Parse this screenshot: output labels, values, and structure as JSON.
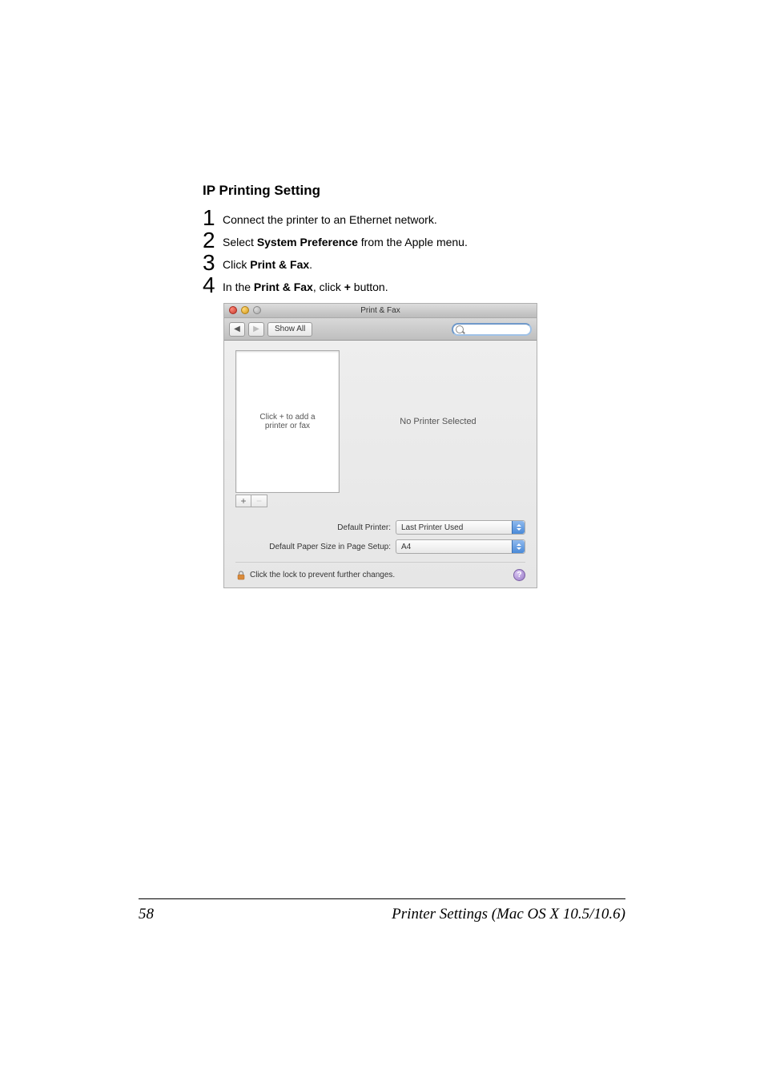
{
  "heading": "IP Printing Setting",
  "steps": [
    {
      "num": "1",
      "text_full": "Connect the printer to an Ethernet network."
    },
    {
      "num": "2",
      "prefix": "Select ",
      "bold": "System Preference",
      "suffix": " from the Apple menu."
    },
    {
      "num": "3",
      "prefix": "Click ",
      "bold": "Print & Fax",
      "suffix": "."
    },
    {
      "num": "4",
      "prefix": "In the ",
      "bold": "Print & Fax",
      "mid": ", click ",
      "bold2": "+",
      "suffix": " button."
    }
  ],
  "window": {
    "title": "Print & Fax",
    "show_all_label": "Show All",
    "back_glyph": "◀",
    "fwd_glyph": "▶",
    "list_placeholder": "Click + to add a\nprinter or fax",
    "right_pane_text": "No Printer Selected",
    "plus": "+",
    "minus": "−",
    "default_printer_label": "Default Printer:",
    "default_printer_value": "Last Printer Used",
    "paper_size_label": "Default Paper Size in Page Setup:",
    "paper_size_value": "A4",
    "lock_text": "Click the lock to prevent further changes.",
    "help_glyph": "?"
  },
  "footer": {
    "page_num": "58",
    "title": "Printer Settings (Mac OS X 10.5/10.6)"
  }
}
